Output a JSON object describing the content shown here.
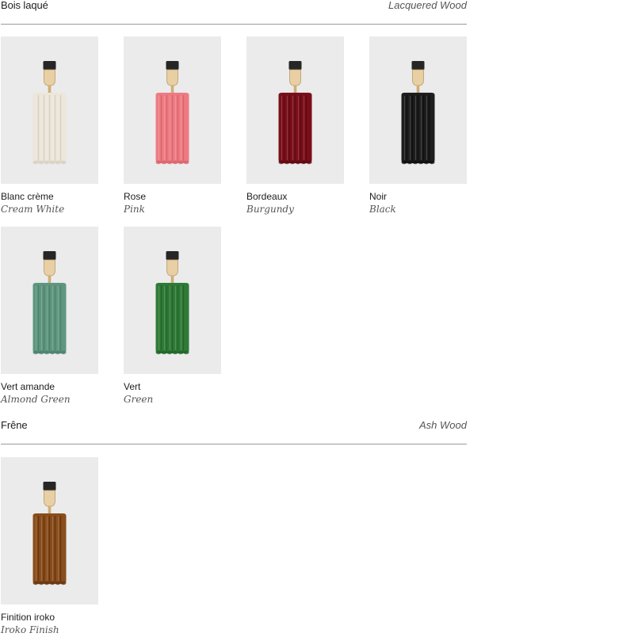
{
  "sections": [
    {
      "title_fr": "Bois laqué",
      "title_en": "Lacquered Wood",
      "swatches": [
        {
          "name_fr": "Blanc crème",
          "name_en": "Cream White",
          "color": "#ece6db",
          "shade": "#d3cbbd"
        },
        {
          "name_fr": "Rose",
          "name_en": "Pink",
          "color": "#ee7b83",
          "shade": "#d45f68"
        },
        {
          "name_fr": "Bordeaux",
          "name_en": "Burgundy",
          "color": "#7a0f1a",
          "shade": "#5a0812"
        },
        {
          "name_fr": "Noir",
          "name_en": "Black",
          "color": "#1e1e1e",
          "shade": "#0c0c0c"
        },
        {
          "name_fr": "Vert amande",
          "name_en": "Almond Green",
          "color": "#5f9680",
          "shade": "#4a7c68"
        },
        {
          "name_fr": "Vert",
          "name_en": "Green",
          "color": "#2f7a36",
          "shade": "#1f5f26"
        }
      ]
    },
    {
      "title_fr": "Frêne",
      "title_en": "Ash Wood",
      "swatches": [
        {
          "name_fr": "Finition iroko",
          "name_en": "Iroko Finish",
          "color": "#8a4d1c",
          "shade": "#5e300c"
        }
      ]
    }
  ]
}
